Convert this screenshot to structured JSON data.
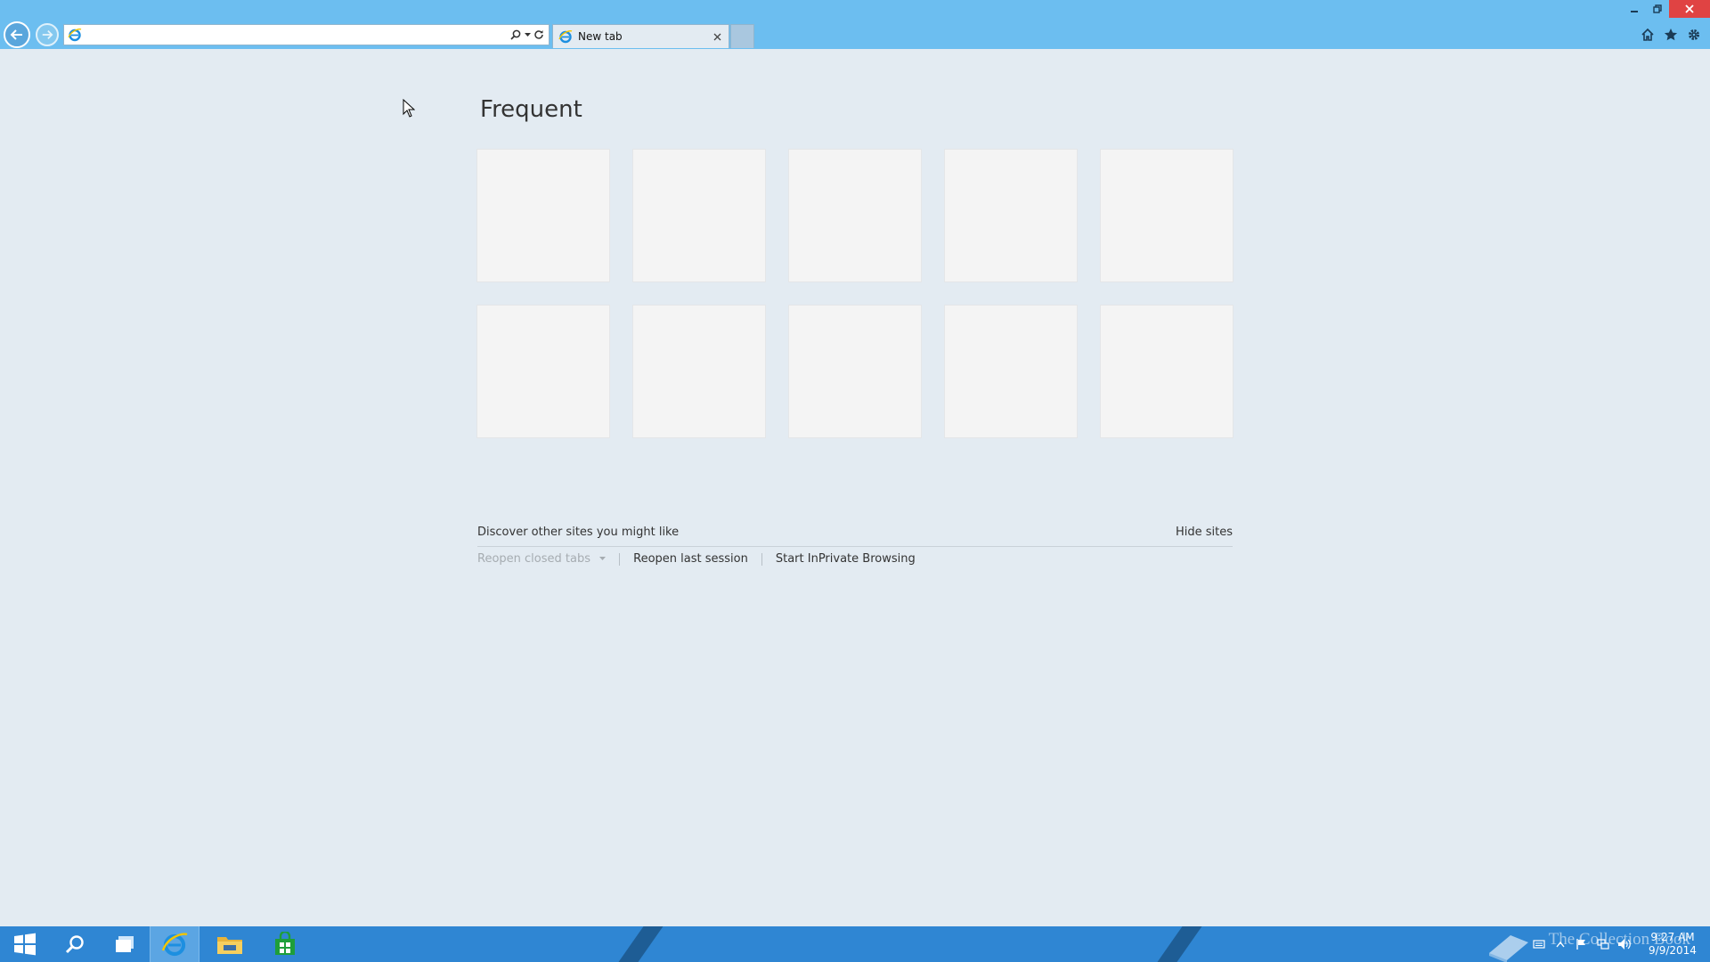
{
  "browser": {
    "address_value": "",
    "tab_title": "New tab"
  },
  "content": {
    "frequent_heading": "Frequent",
    "discover_text": "Discover other sites you might like",
    "hide_sites_label": "Hide sites",
    "reopen_closed_tabs_label": "Reopen closed tabs",
    "reopen_last_session_label": "Reopen last session",
    "inprivate_label": "Start InPrivate Browsing"
  },
  "taskbar": {
    "clock_time": "9:27 AM",
    "clock_date": "9/9/2014",
    "watermark_text": "The Collection Book"
  },
  "colors": {
    "chrome_bar": "#6cbef0",
    "page_background": "#e3ebf2",
    "taskbar": "#2f86d3",
    "close_button": "#e04343",
    "store_green": "#1e9e3a"
  },
  "icons": {
    "back": "back-arrow-icon",
    "forward": "forward-arrow-icon",
    "site": "ie-logo-icon",
    "search": "search-icon",
    "refresh": "refresh-icon",
    "home": "home-icon",
    "favorites": "star-icon",
    "tools": "gear-icon"
  }
}
